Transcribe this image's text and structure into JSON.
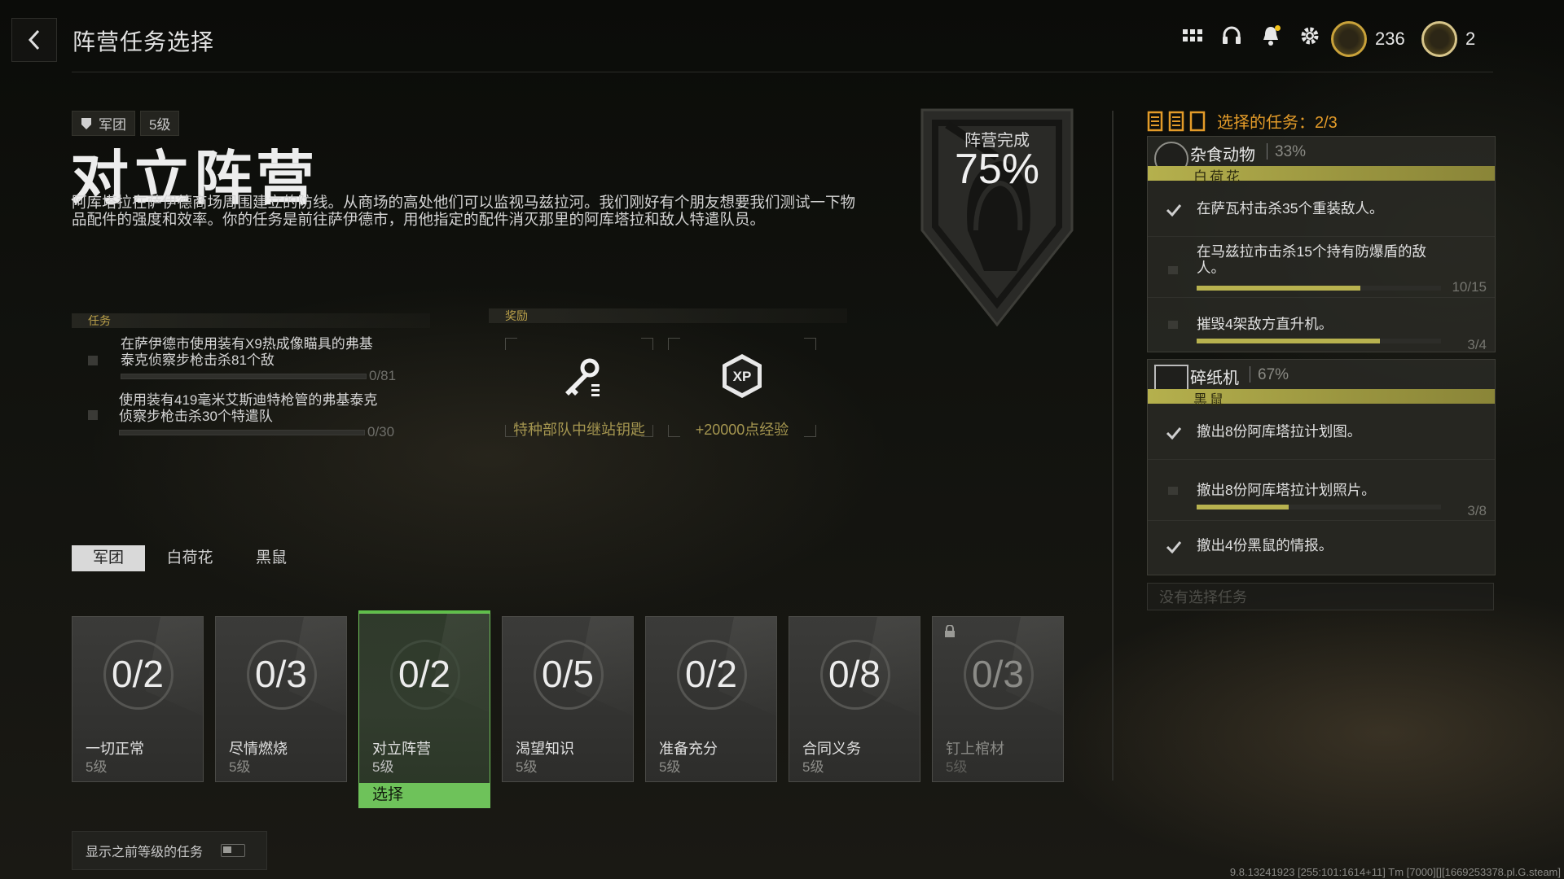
{
  "header": {
    "title": "阵营任务选择",
    "currency1": "236",
    "currency2": "2"
  },
  "mission": {
    "tag_faction": "军团",
    "tag_level": "5级",
    "title": "对立阵营",
    "description": "阿库塔拉在萨伊德商场周围建立的防线。从商场的高处他们可以监视马兹拉河。我们刚好有个朋友想要我们测试一下物品配件的强度和效率。你的任务是前往萨伊德市，用他指定的配件消灭那里的阿库塔拉和敌人特遣队员。"
  },
  "faction_emblem": {
    "label": "阵营完成",
    "percent": "75%"
  },
  "tasks": {
    "heading": "任务",
    "items": [
      {
        "text": "在萨伊德市使用装有X9热成像瞄具的弗基泰克侦察步枪击杀81个敌",
        "count": "0/81",
        "progress": 0
      },
      {
        "text": "使用装有419毫米艾斯迪特枪管的弗基泰克侦察步枪击杀30个特遣队",
        "count": "0/30",
        "progress": 0
      }
    ]
  },
  "rewards": {
    "heading": "奖励",
    "items": [
      {
        "label": "特种部队中继站钥匙",
        "icon": "key-icon"
      },
      {
        "label": "+20000点经验",
        "icon": "xp-icon"
      }
    ]
  },
  "faction_tabs": [
    "军团",
    "白荷花",
    "黑鼠"
  ],
  "cards": [
    {
      "count": "0/2",
      "name": "一切正常",
      "level": "5级"
    },
    {
      "count": "0/3",
      "name": "尽情燃烧",
      "level": "5级"
    },
    {
      "count": "0/2",
      "name": "对立阵营",
      "level": "5级",
      "select": "选择"
    },
    {
      "count": "0/5",
      "name": "渴望知识",
      "level": "5级"
    },
    {
      "count": "0/2",
      "name": "准备充分",
      "level": "5级"
    },
    {
      "count": "0/8",
      "name": "合同义务",
      "level": "5级"
    },
    {
      "count": "0/3",
      "name": "钉上棺材",
      "level": "5级",
      "locked": true
    }
  ],
  "toggle_label": "显示之前等级的任务",
  "selected": {
    "heading": "选择的任务：2/3",
    "panels": [
      {
        "name": "杂食动物",
        "percent": "33%",
        "faction": "白荷花",
        "tasks": [
          {
            "text": "在萨瓦村击杀35个重装敌人。",
            "done": true
          },
          {
            "text": "在马兹拉市击杀15个持有防爆盾的敌人。",
            "count": "10/15",
            "progress": 0.67
          },
          {
            "text": "摧毁4架敌方直升机。",
            "count": "3/4",
            "progress": 0.75
          }
        ]
      },
      {
        "name": "碎纸机",
        "percent": "67%",
        "faction": "黑鼠",
        "tasks": [
          {
            "text": "撤出8份阿库塔拉计划图。",
            "done": true
          },
          {
            "text": "撤出8份阿库塔拉计划照片。",
            "count": "3/8",
            "progress": 0.375
          },
          {
            "text": "撤出4份黑鼠的情报。",
            "done": true
          }
        ]
      }
    ],
    "empty_slot": "没有选择任务"
  },
  "version": "9.8.13241923 [255:101:1614+11] Tm [7000][][1669253378.pl.G.steam]"
}
